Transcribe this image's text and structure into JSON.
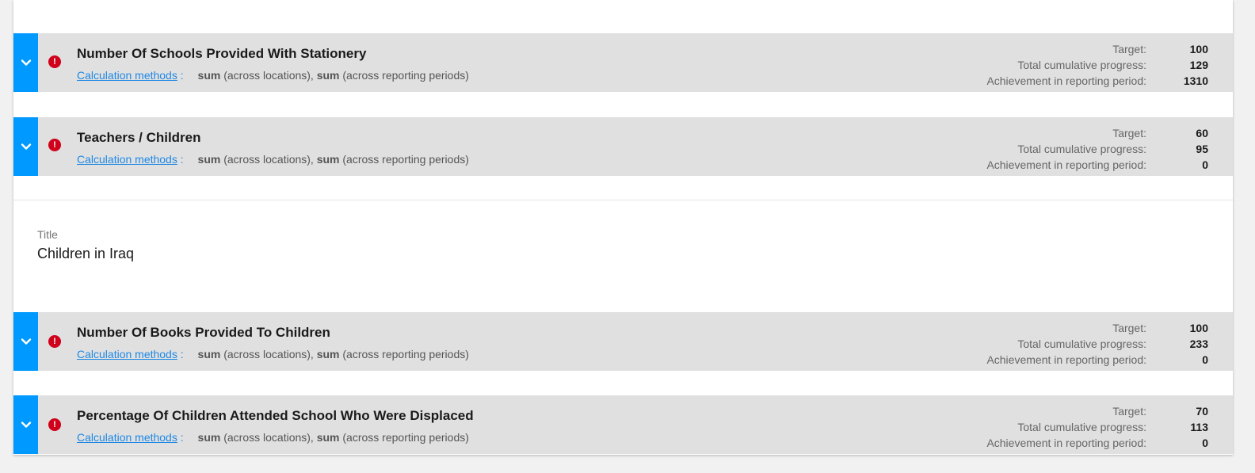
{
  "calc": {
    "link_label": "Calculation methods",
    "separator": ":",
    "method1": "sum",
    "scope1": "(across locations),",
    "method2": "sum",
    "scope2": "(across reporting periods)"
  },
  "stat_labels": {
    "target": "Target:",
    "cumulative": "Total cumulative progress:",
    "achievement": "Achievement in reporting period:"
  },
  "group": {
    "label": "Title",
    "title": "Children in Iraq"
  },
  "indicators": [
    {
      "title": "Number Of Schools Provided With Stationery",
      "target": "100",
      "cumulative": "129",
      "achievement": "1310"
    },
    {
      "title": "Teachers / Children",
      "target": "60",
      "cumulative": "95",
      "achievement": "0"
    },
    {
      "title": "Number Of Books Provided To Children",
      "target": "100",
      "cumulative": "233",
      "achievement": "0"
    },
    {
      "title": "Percentage Of Children Attended School Who Were Displaced",
      "target": "70",
      "cumulative": "113",
      "achievement": "0"
    }
  ],
  "colors": {
    "expand_button": "#0099ff",
    "alert_icon": "#d0021b",
    "row_background": "#e0e0e0",
    "link": "#1e88e5"
  },
  "icons": {
    "expand": "chevron-down-icon",
    "alert": "exclamation-circle-icon"
  }
}
